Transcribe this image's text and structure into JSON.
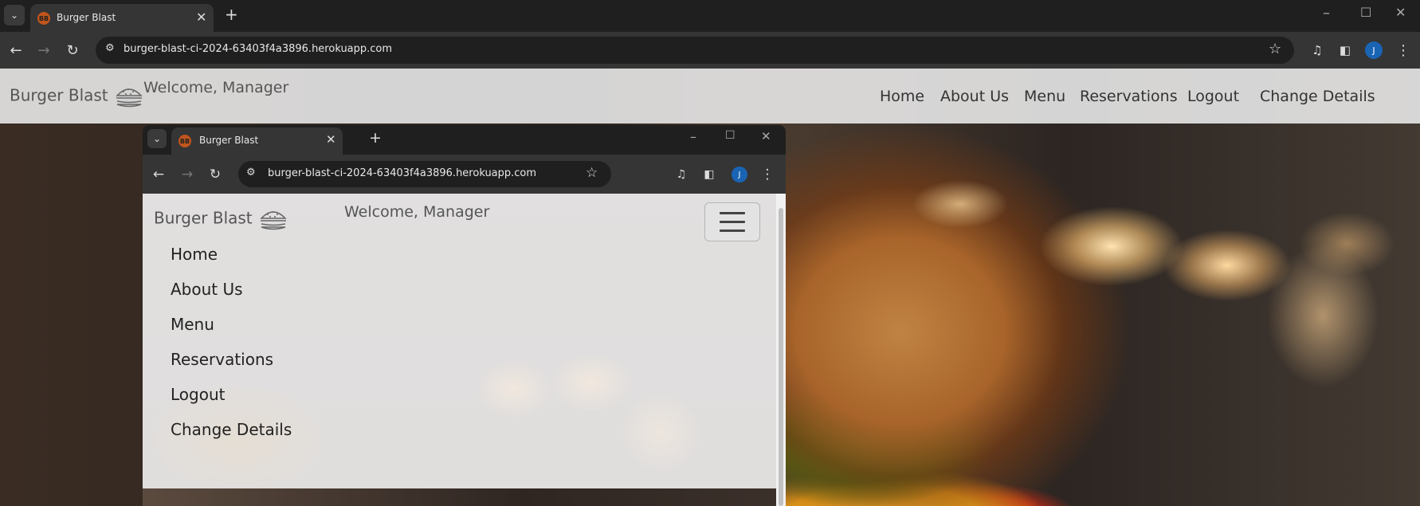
{
  "outer_browser": {
    "tab_title": "Burger Blast",
    "favicon_text": "BB",
    "url": "burger-blast-ci-2024-63403f4a3896.herokuapp.com",
    "avatar_letter": "J"
  },
  "site": {
    "brand": "Burger Blast",
    "welcome": "Welcome, Manager",
    "nav": [
      "Home",
      "About Us",
      "Menu",
      "Reservations",
      "Logout",
      "Change Details"
    ]
  },
  "inner_browser": {
    "tab_title": "Burger Blast",
    "favicon_text": "BB",
    "url": "burger-blast-ci-2024-63403f4a3896.herokuapp.com",
    "avatar_letter": "J"
  },
  "inner_site": {
    "brand": "Burger Blast",
    "welcome": "Welcome, Manager",
    "menu": [
      "Home",
      "About Us",
      "Menu",
      "Reservations",
      "Logout",
      "Change Details"
    ]
  },
  "colors": {
    "chrome_dark": "#1f1f1f",
    "chrome_toolbar": "#353535",
    "favicon": "#c1551c",
    "avatar": "#1a64b4"
  }
}
